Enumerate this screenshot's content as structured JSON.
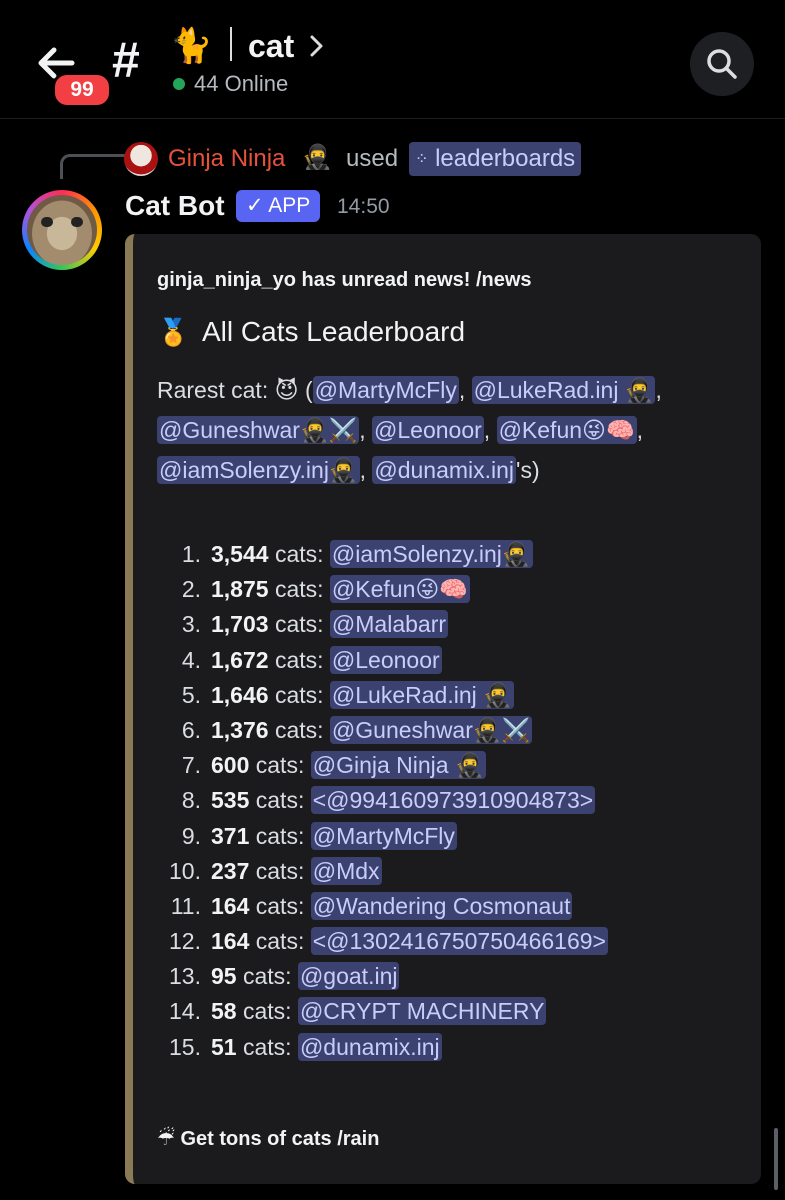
{
  "header": {
    "unread_badge": "99",
    "channel_emoji": "🐈",
    "channel_name": "cat",
    "online_text": "44 Online"
  },
  "reply": {
    "user": "Ginja Ninja",
    "user_emoji": "🥷",
    "action": "used",
    "command": "leaderboards"
  },
  "message": {
    "author": "Cat Bot",
    "app_badge": "✓ APP",
    "time": "14:50"
  },
  "embed": {
    "news_line": "ginja_ninja_yo has unread news! /news",
    "title_emoji": "🏅",
    "title": "All Cats Leaderboard",
    "rarest_prefix": "Rarest cat:",
    "rarest_emoji": "😈",
    "rarest_mentions": [
      "@MartyMcFly",
      "@LukeRad.inj 🥷",
      "@Guneshwar🥷⚔️",
      "@Leonoor",
      "@Kefun😜🧠",
      "@iamSolenzy.inj🥷",
      "@dunamix.inj"
    ],
    "rarest_suffix": "'s)",
    "leaderboard": [
      {
        "rank": "1.",
        "count": "3,544",
        "unit": "cats:",
        "user": "@iamSolenzy.inj🥷"
      },
      {
        "rank": "2.",
        "count": "1,875",
        "unit": "cats:",
        "user": "@Kefun😜🧠"
      },
      {
        "rank": "3.",
        "count": "1,703",
        "unit": "cats:",
        "user": "@Malabarr"
      },
      {
        "rank": "4.",
        "count": "1,672",
        "unit": "cats:",
        "user": "@Leonoor"
      },
      {
        "rank": "5.",
        "count": "1,646",
        "unit": "cats:",
        "user": "@LukeRad.inj 🥷"
      },
      {
        "rank": "6.",
        "count": "1,376",
        "unit": "cats:",
        "user": "@Guneshwar🥷⚔️"
      },
      {
        "rank": "7.",
        "count": "600",
        "unit": "cats:",
        "user": "@Ginja Ninja 🥷"
      },
      {
        "rank": "8.",
        "count": "535",
        "unit": "cats:",
        "user": "<@994160973910904873>"
      },
      {
        "rank": "9.",
        "count": "371",
        "unit": "cats:",
        "user": "@MartyMcFly"
      },
      {
        "rank": "10.",
        "count": "237",
        "unit": "cats:",
        "user": "@Mdx"
      },
      {
        "rank": "11.",
        "count": "164",
        "unit": "cats:",
        "user": "@Wandering Cosmonaut"
      },
      {
        "rank": "12.",
        "count": "164",
        "unit": "cats:",
        "user": "<@1302416750750466169>"
      },
      {
        "rank": "13.",
        "count": "95",
        "unit": "cats:",
        "user": "@goat.inj"
      },
      {
        "rank": "14.",
        "count": "58",
        "unit": "cats:",
        "user": "@CRYPT MACHINERY"
      },
      {
        "rank": "15.",
        "count": "51",
        "unit": "cats:",
        "user": "@dunamix.inj"
      }
    ],
    "footer_emoji": "☔",
    "footer": "Get tons of cats /rain"
  },
  "icons": {
    "back": "back-arrow-icon",
    "search": "search-icon",
    "chevron": "chevron-right-icon",
    "slash_command": "slash-command-icon"
  },
  "colors": {
    "background": "#000000",
    "mention_bg": "#3c4270",
    "mention_text": "#c9cdfb",
    "app_badge": "#5865f2",
    "online": "#23a55a",
    "unread_badge": "#f23f43",
    "reply_user": "#e8513c",
    "embed_bar": "#8a7a55"
  }
}
